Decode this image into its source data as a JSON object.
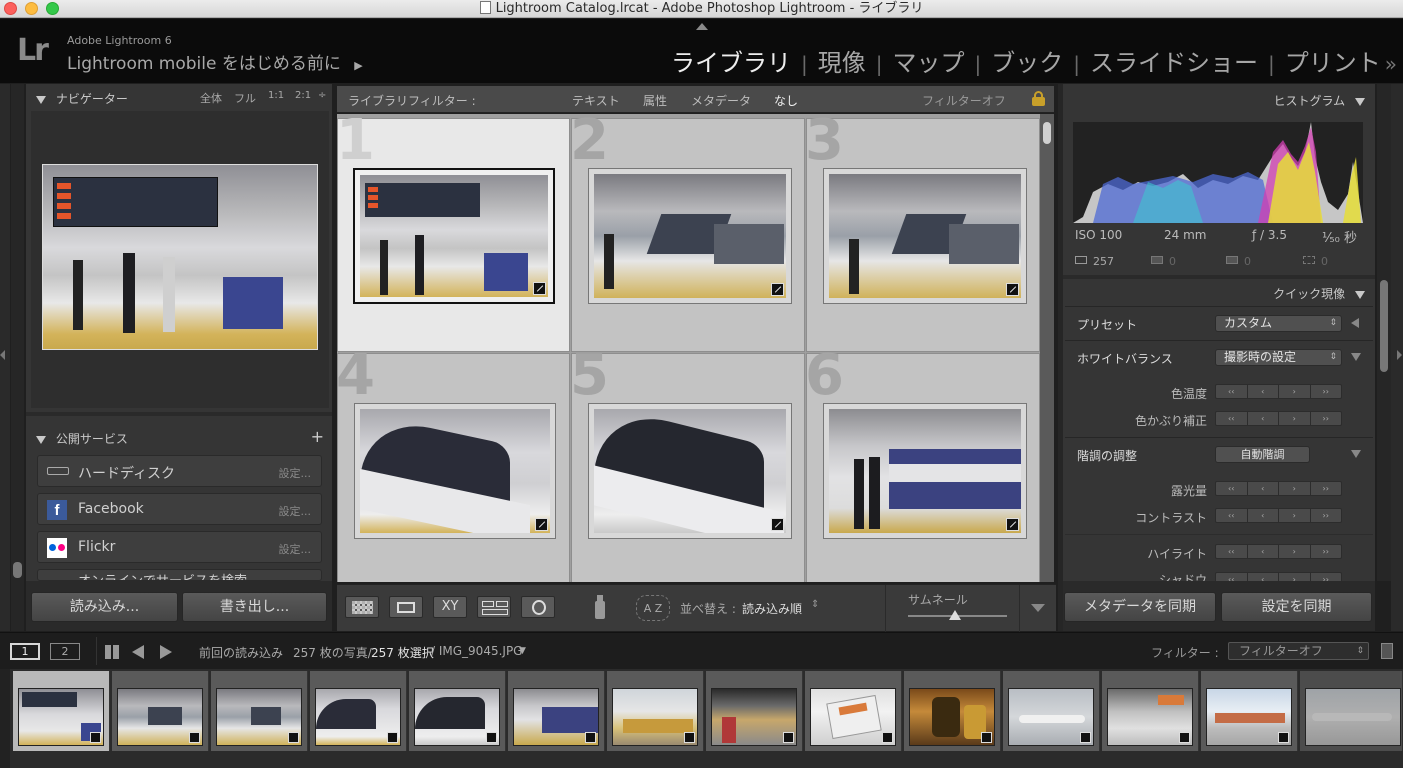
{
  "window": {
    "title": "Lightroom Catalog.lrcat - Adobe Photoshop Lightroom - ライブラリ"
  },
  "identity": {
    "product": "Adobe Lightroom 6",
    "tagline": "Lightroom mobile をはじめる前に",
    "tagline_arrow": "▶"
  },
  "modules": [
    {
      "label": "ライブラリ",
      "active": true
    },
    {
      "label": "現像"
    },
    {
      "label": "マップ"
    },
    {
      "label": "ブック"
    },
    {
      "label": "スライドショー"
    },
    {
      "label": "プリント"
    }
  ],
  "modules_more": "»",
  "modules_separator": "|",
  "navigator": {
    "title": "ナビゲーター",
    "zoom": [
      "全体",
      "フル",
      "1:1",
      "2:1"
    ],
    "zoom_menu": "÷"
  },
  "publish": {
    "title": "公開サービス",
    "add": "+",
    "items": [
      {
        "label": "ハードディスク",
        "settings": "設定..."
      },
      {
        "label": "Facebook",
        "settings": "設定..."
      },
      {
        "label": "Flickr",
        "settings": "設定..."
      },
      {
        "label": "オンラインでサービスを検索..."
      }
    ]
  },
  "left_buttons": {
    "import": "読み込み...",
    "export": "書き出し..."
  },
  "filter_bar": {
    "label": "ライブラリフィルター :",
    "tabs": [
      "テキスト",
      "属性",
      "メタデータ",
      "なし"
    ],
    "active_tab": "なし",
    "preset": "フィルターオフ"
  },
  "grid": {
    "cells": [
      {
        "num": "1",
        "selected": true
      },
      {
        "num": "2"
      },
      {
        "num": "3"
      },
      {
        "num": "4"
      },
      {
        "num": "5"
      },
      {
        "num": "6"
      }
    ]
  },
  "toolbar": {
    "sort_label": "並べ替え :",
    "sort_value": "読み込み順",
    "thumb_label": "サムネール",
    "sort_az": "A Z"
  },
  "histogram": {
    "title": "ヒストグラム",
    "iso": "ISO 100",
    "focal": "24 mm",
    "aperture": "ƒ / 3.5",
    "shutter": "¹⁄₅₀ 秒",
    "counts": [
      "257",
      "0",
      "0",
      "0"
    ]
  },
  "quick_develop": {
    "title": "クイック現像",
    "preset_label": "プリセット",
    "preset_value": "カスタム",
    "wb_label": "ホワイトバランス",
    "wb_value": "撮影時の設定",
    "temp_label": "色温度",
    "tint_label": "色かぶり補正",
    "tone_label": "階調の調整",
    "auto_tone": "自動階調",
    "exposure_label": "露光量",
    "contrast_label": "コントラスト",
    "highlights_label": "ハイライト",
    "shadows_label": "シャドウ",
    "stepper": [
      "‹‹",
      "‹",
      "›",
      "››"
    ]
  },
  "right_buttons": {
    "sync_meta": "メタデータを同期",
    "sync_settings": "設定を同期"
  },
  "filmstrip_bar": {
    "screen1": "1",
    "screen2": "2",
    "source": "前回の読み込み",
    "count_a": "257 枚の写真/",
    "count_b": "257 枚選択",
    "count_c": "/ IMG_9045.JPG",
    "filter_label": "フィルター :",
    "filter_value": "フィルターオフ"
  },
  "colors": {
    "accent": "#eeeeee",
    "panel": "#353535",
    "lock": "#c8a02a"
  }
}
